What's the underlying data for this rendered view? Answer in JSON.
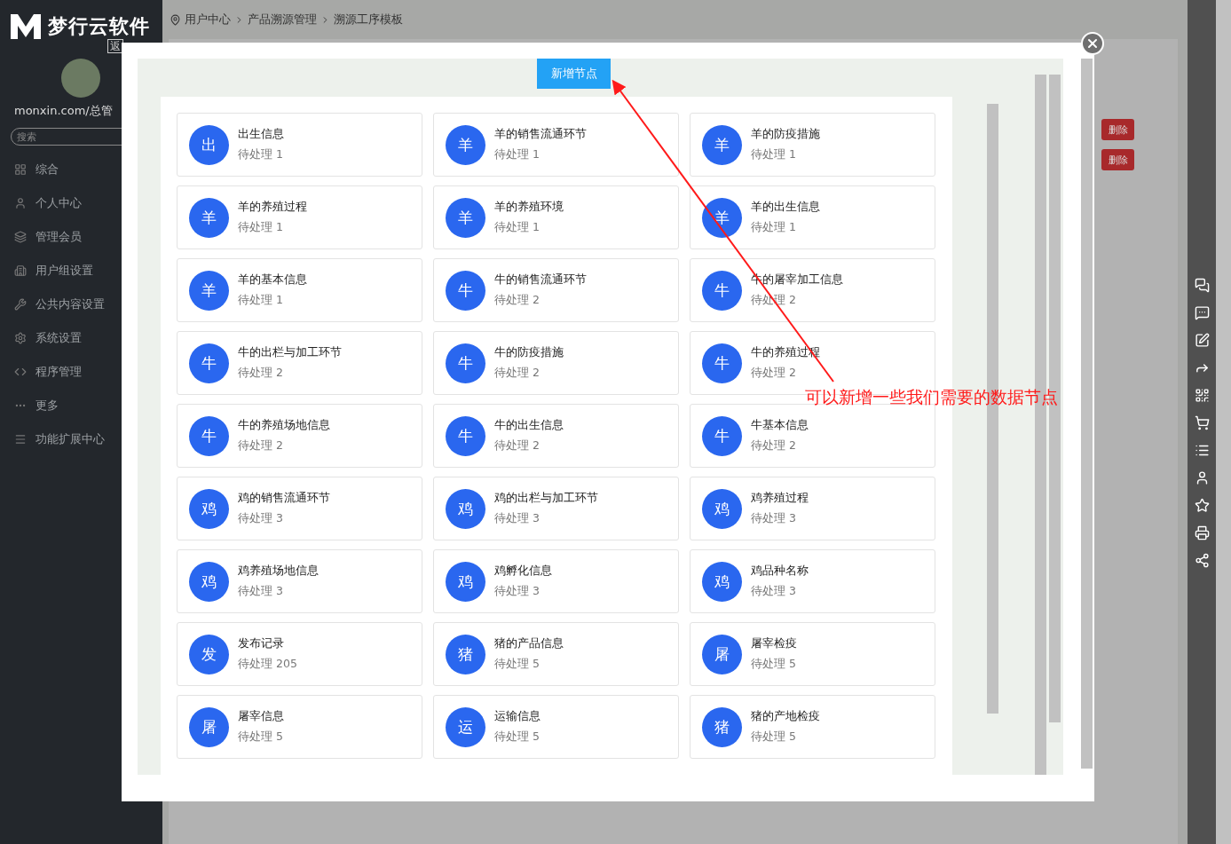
{
  "logo": {
    "text": "梦行云软件",
    "badge": "返"
  },
  "user": {
    "name": "monxin.com/总管"
  },
  "search": {
    "placeholder": "搜索"
  },
  "sidebar": {
    "items": [
      {
        "label": "综合"
      },
      {
        "label": "个人中心"
      },
      {
        "label": "管理会员"
      },
      {
        "label": "用户组设置"
      },
      {
        "label": "公共内容设置"
      },
      {
        "label": "系统设置"
      },
      {
        "label": "程序管理"
      },
      {
        "label": "更多"
      },
      {
        "label": "功能扩展中心"
      }
    ]
  },
  "breadcrumb": [
    "用户中心",
    "产品溯源管理",
    "溯源工序模板"
  ],
  "background_rows": [
    {
      "action": "删除"
    },
    {
      "action": "删除"
    }
  ],
  "modal": {
    "add_button": "新增节点",
    "nodes": [
      {
        "avatar": "出",
        "title": "出生信息",
        "status": "待处理 1"
      },
      {
        "avatar": "羊",
        "title": "羊的销售流通环节",
        "status": "待处理 1"
      },
      {
        "avatar": "羊",
        "title": "羊的防疫措施",
        "status": "待处理 1"
      },
      {
        "avatar": "羊",
        "title": "羊的养殖过程",
        "status": "待处理 1"
      },
      {
        "avatar": "羊",
        "title": "羊的养殖环境",
        "status": "待处理 1"
      },
      {
        "avatar": "羊",
        "title": "羊的出生信息",
        "status": "待处理 1"
      },
      {
        "avatar": "羊",
        "title": "羊的基本信息",
        "status": "待处理 1"
      },
      {
        "avatar": "牛",
        "title": "牛的销售流通环节",
        "status": "待处理 2"
      },
      {
        "avatar": "牛",
        "title": "牛的屠宰加工信息",
        "status": "待处理 2"
      },
      {
        "avatar": "牛",
        "title": "牛的出栏与加工环节",
        "status": "待处理 2"
      },
      {
        "avatar": "牛",
        "title": "牛的防疫措施",
        "status": "待处理 2"
      },
      {
        "avatar": "牛",
        "title": "牛的养殖过程",
        "status": "待处理 2"
      },
      {
        "avatar": "牛",
        "title": "牛的养殖场地信息",
        "status": "待处理 2"
      },
      {
        "avatar": "牛",
        "title": "牛的出生信息",
        "status": "待处理 2"
      },
      {
        "avatar": "牛",
        "title": "牛基本信息",
        "status": "待处理 2"
      },
      {
        "avatar": "鸡",
        "title": "鸡的销售流通环节",
        "status": "待处理 3"
      },
      {
        "avatar": "鸡",
        "title": "鸡的出栏与加工环节",
        "status": "待处理 3"
      },
      {
        "avatar": "鸡",
        "title": "鸡养殖过程",
        "status": "待处理 3"
      },
      {
        "avatar": "鸡",
        "title": "鸡养殖场地信息",
        "status": "待处理 3"
      },
      {
        "avatar": "鸡",
        "title": "鸡孵化信息",
        "status": "待处理 3"
      },
      {
        "avatar": "鸡",
        "title": "鸡品种名称",
        "status": "待处理 3"
      },
      {
        "avatar": "发",
        "title": "发布记录",
        "status": "待处理 205"
      },
      {
        "avatar": "猪",
        "title": "猪的产品信息",
        "status": "待处理 5"
      },
      {
        "avatar": "屠",
        "title": "屠宰检疫",
        "status": "待处理 5"
      },
      {
        "avatar": "屠",
        "title": "屠宰信息",
        "status": "待处理 5"
      },
      {
        "avatar": "运",
        "title": "运输信息",
        "status": "待处理 5"
      },
      {
        "avatar": "猪",
        "title": "猪的产地检疫",
        "status": "待处理 5"
      }
    ]
  },
  "annotation": {
    "text": "可以新增一些我们需要的数据节点"
  }
}
